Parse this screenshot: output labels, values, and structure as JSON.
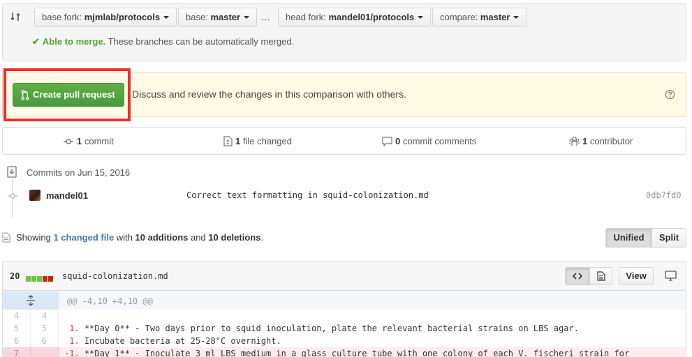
{
  "compare": {
    "base_fork_label": "base fork:",
    "base_fork_value": "mjmlab/protocols",
    "base_label": "base:",
    "base_value": "master",
    "ellipsis": "…",
    "head_fork_label": "head fork:",
    "head_fork_value": "mandel01/protocols",
    "compare_label": "compare:",
    "compare_value": "master",
    "merge_check": "✔",
    "merge_status": "Able to merge.",
    "merge_detail": " These branches can be automatically merged."
  },
  "pull_request": {
    "button_label": "Create pull request",
    "description": "Discuss and review the changes in this comparison with others."
  },
  "stats": {
    "commits_count": "1",
    "commits_label": " commit",
    "files_count": "1",
    "files_label": " file changed",
    "comments_count": "0",
    "comments_label": " commit comments",
    "contributors_count": "1",
    "contributors_label": " contributor"
  },
  "commits": {
    "date_heading": "Commits on Jun 15, 2016",
    "items": [
      {
        "author": "mandel01",
        "message": "Correct text formatting in squid-colonization.md",
        "sha": "0db7fd0"
      }
    ]
  },
  "summary": {
    "showing": "Showing ",
    "changed_link": "1 changed file",
    "with": " with ",
    "additions": "10 additions",
    "and": " and ",
    "deletions": "10 deletions",
    "period": "."
  },
  "view_toggle": {
    "unified": "Unified",
    "split": "Split",
    "selected": "Unified"
  },
  "file": {
    "change_count": "20",
    "diffstat": [
      "added",
      "added",
      "added",
      "deleted",
      "deleted"
    ],
    "name": "squid-colonization.md",
    "view_label": "View",
    "hunk_header": "@@ -4,10 +4,10 @@",
    "lines": [
      {
        "type": "context",
        "old": "4",
        "new": "4",
        "prefix": " ",
        "num": "",
        "text": ""
      },
      {
        "type": "context",
        "old": "5",
        "new": "5",
        "prefix": " ",
        "num": "1.",
        "text": " **Day 0** - Two days prior to squid inoculation, plate the relevant bacterial strains on LBS agar."
      },
      {
        "type": "context",
        "old": "6",
        "new": "6",
        "prefix": " ",
        "num": "1.",
        "text": " Incubate bacteria at 25-28°C overnight."
      },
      {
        "type": "deletion",
        "old": "7",
        "new": "",
        "prefix": "-",
        "num": "1.",
        "text": " **Day 1** - Inoculate 3 ml LBS medium in a glass culture tube with one colony of each V. fischeri strain for"
      }
    ]
  },
  "colors": {
    "green_button": "#60b044",
    "added_block": "#6cc644",
    "deleted_block": "#bd2c00",
    "highlight_frame": "#f02b2b",
    "link": "#4078c0"
  }
}
